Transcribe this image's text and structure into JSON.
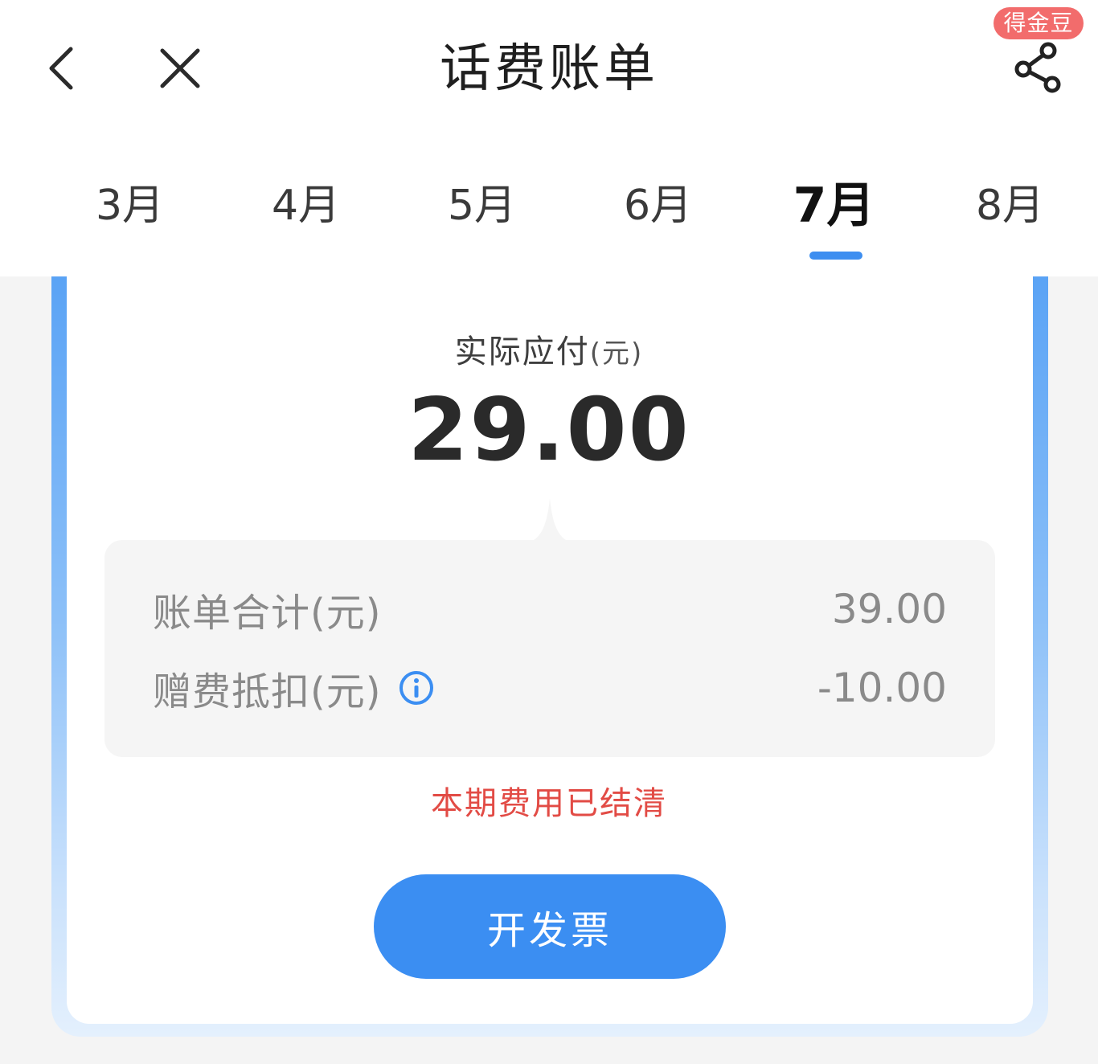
{
  "header": {
    "title": "话费账单",
    "badge": "得金豆",
    "back_icon": "chevron-left-icon",
    "close_icon": "close-icon",
    "share_icon": "share-icon"
  },
  "tabs": [
    {
      "label": "3月",
      "active": false
    },
    {
      "label": "4月",
      "active": false
    },
    {
      "label": "5月",
      "active": false
    },
    {
      "label": "6月",
      "active": false
    },
    {
      "label": "7月",
      "active": true
    },
    {
      "label": "8月",
      "active": false
    }
  ],
  "bill": {
    "pay_label": "实际应付",
    "pay_unit": "(元)",
    "pay_amount": "29.00",
    "rows": [
      {
        "label": "账单合计(元)",
        "value": "39.00"
      },
      {
        "label": "赠费抵扣(元)",
        "value": "-10.00",
        "icon": "info-icon"
      }
    ],
    "status": "本期费用已结清",
    "invoice_button": "开发票"
  },
  "colors": {
    "accent": "#3b8ef2",
    "status_red": "#e24b45",
    "badge_red": "#f26c6c"
  }
}
